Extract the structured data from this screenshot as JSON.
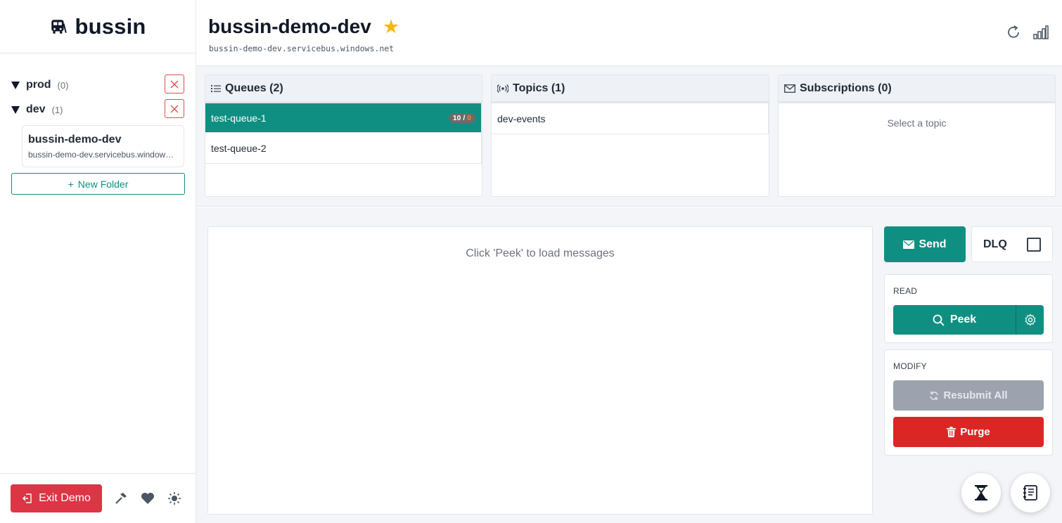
{
  "app": {
    "name": "bussin",
    "logo_icon": "bus-icon"
  },
  "sidebar": {
    "folders": [
      {
        "name": "prod",
        "count": "(0)",
        "delete_icon": "close-icon"
      },
      {
        "name": "dev",
        "count": "(1)",
        "delete_icon": "close-icon"
      }
    ],
    "connection": {
      "name": "bussin-demo-dev",
      "host": "bussin-demo-dev.servicebus.windows.net"
    },
    "new_folder_label": "New Folder",
    "exit_label": "Exit Demo",
    "footer_icons": [
      "hammer-icon",
      "heart-icon",
      "sun-icon"
    ]
  },
  "header": {
    "title": "bussin-demo-dev",
    "host": "bussin-demo-dev.servicebus.windows.net",
    "favorite": true,
    "actions": [
      "refresh-icon",
      "stats-icon"
    ]
  },
  "queues": {
    "title": "Queues (2)",
    "items": [
      {
        "name": "test-queue-1",
        "active": true,
        "active_count": "10",
        "separator": "/",
        "dlq_count": "0"
      },
      {
        "name": "test-queue-2",
        "active": false
      }
    ]
  },
  "topics": {
    "title": "Topics (1)",
    "items": [
      {
        "name": "dev-events"
      }
    ]
  },
  "subscriptions": {
    "title": "Subscriptions (0)",
    "empty": "Select a topic"
  },
  "messages": {
    "empty": "Click 'Peek' to load messages"
  },
  "actions": {
    "send_label": "Send",
    "dlq_label": "DLQ",
    "dlq_checked": false,
    "read_title": "READ",
    "peek_label": "Peek",
    "modify_title": "MODIFY",
    "resubmit_label": "Resubmit All",
    "purge_label": "Purge"
  },
  "colors": {
    "accent": "#0f8f81",
    "danger": "#dc2626",
    "exit": "#dc3545",
    "star": "#f5b700"
  }
}
